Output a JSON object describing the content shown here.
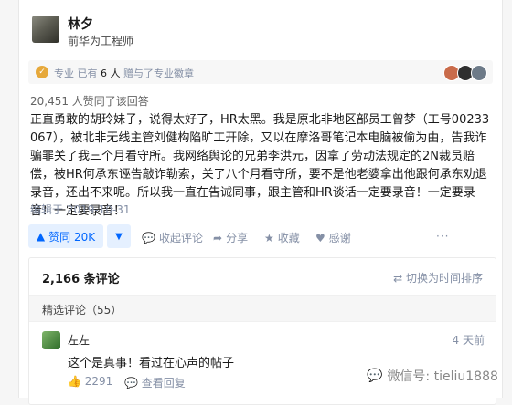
{
  "author": {
    "name": "林夕",
    "bio": "前华为工程师"
  },
  "badge": {
    "prefix": "专业",
    "text_a": "已有",
    "count": "6 人",
    "text_b": "赠与了专业徽章"
  },
  "answer": {
    "upvote_text": "20,451 人赞同了该回答",
    "content": "正直勇敢的胡玲妹子，说得太好了，HR太黑。我是原北非地区部员工曾梦（工号00233067），被北非无线主管刘健构陷旷工开除，又以在摩洛哥笔记本电脑被偷为由，告我诈骗罪关了我三个月看守所。我网络舆论的兄弟李洪元，因拿了劳动法规定的2N裁员赔偿，被HR何承东诬告敲诈勒索，关了八个月看守所，要不是他老婆拿出他跟何承东劝退录音，还出不来呢。所以我一直在告诫同事，跟主管和HR谈话一定要录音！一定要录音！一定要录音！",
    "edited": "编辑于 2019-10-31"
  },
  "actions": {
    "vote_label": "赞同 20K",
    "collapse_label": "收起评论",
    "share_label": "分享",
    "favorite_label": "收藏",
    "thanks_label": "感谢",
    "more_label": "···"
  },
  "comments": {
    "count_label": "2,166 条评论",
    "sort_label": "切换为时间排序",
    "featured_label": "精选评论（55）",
    "items": [
      {
        "user": "左左",
        "time": "4 天前",
        "text": "这个是真事！看过在心声的帖子",
        "likes": "2291",
        "reply_label": "查看回复"
      }
    ]
  },
  "watermark": {
    "text": "微信号: tieliu1888"
  }
}
